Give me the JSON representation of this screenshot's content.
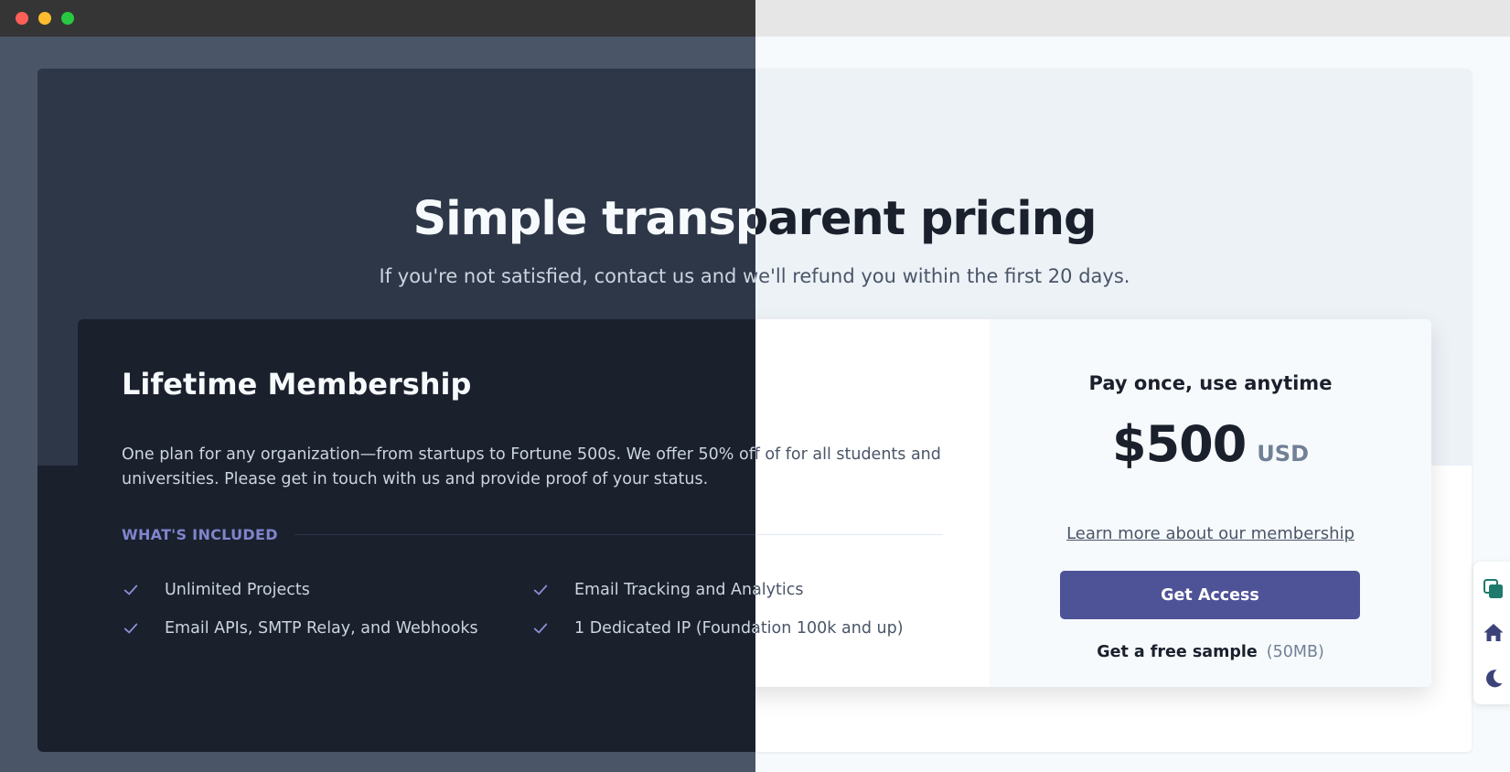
{
  "window": {
    "controls": [
      "close",
      "minimize",
      "maximize"
    ]
  },
  "hero": {
    "title": "Simple transparent pricing",
    "subtitle": "If you're not satisfied, contact us and we'll refund you within the first 20 days."
  },
  "plan": {
    "title": "Lifetime Membership",
    "description": "One plan for any organization—from startups to Fortune 500s. We offer 50% off of for all students and universities. Please get in touch with us and provide proof of your status.",
    "included_label": "WHAT'S INCLUDED",
    "features": [
      "Unlimited Projects",
      "Email Tracking and Analytics",
      "Email APIs, SMTP Relay, and Webhooks",
      "1 Dedicated IP (Foundation 100k and up)"
    ]
  },
  "purchase": {
    "pay_label": "Pay once, use anytime",
    "price": "$500",
    "currency": "USD",
    "learn_more": "Learn more about our membership",
    "access_button": "Get Access",
    "sample_label": "Get a free sample",
    "sample_size": "(50MB)"
  },
  "side_toolbar": {
    "icons": [
      "copy-icon",
      "home-icon",
      "moon-icon"
    ]
  },
  "colors": {
    "accent": "#4e5297",
    "dark_bg": "#1a202c",
    "dark_hero": "#2d3748",
    "light_hero": "#edf2f7",
    "light_card_right": "#f7fafc",
    "toolbar_icon": "#3b4379",
    "copy_icon": "#1f7a6e"
  }
}
